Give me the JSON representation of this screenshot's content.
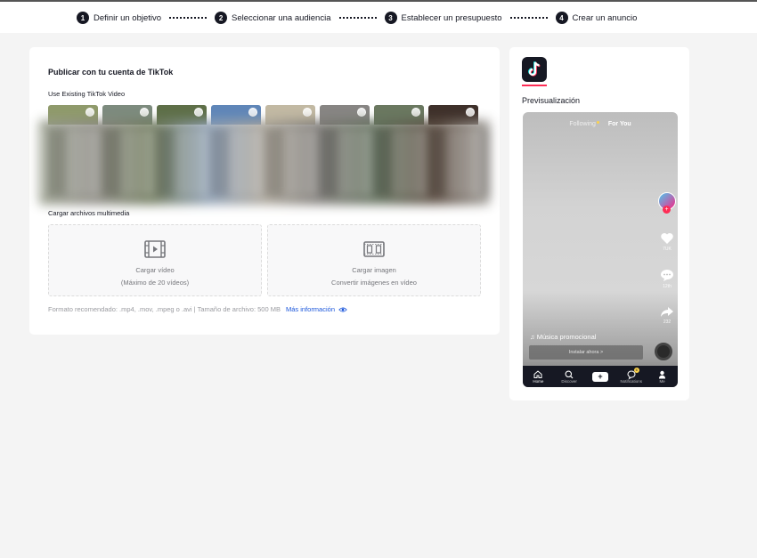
{
  "steps": [
    {
      "num": "1",
      "label": "Definir un objetivo"
    },
    {
      "num": "2",
      "label": "Seleccionar una audiencia"
    },
    {
      "num": "3",
      "label": "Establecer un presupuesto"
    },
    {
      "num": "4",
      "label": "Crear un anuncio"
    }
  ],
  "main": {
    "title": "Publicar con tu cuenta de TikTok",
    "existing_label": "Use Existing TikTok Video",
    "upload_section_label": "Cargar archivos multimedia",
    "upload_video": {
      "title": "Cargar vídeo",
      "subtitle": "(Máximo de 20 vídeos)",
      "icon": "video-icon"
    },
    "upload_image": {
      "title": "Cargar imagen",
      "subtitle": "Convertir imágenes en vídeo",
      "icon": "image-strip-icon"
    },
    "footnote": "Formato recomendado: .mp4, .mov, .mpeg o .avi | Tamaño de archivo: 500 MB",
    "more_info": "Más información",
    "thumb_colors": [
      "#8f9a6b",
      "#7d8b7e",
      "#5e6f48",
      "#5f86b8",
      "#c2b9a3",
      "#878583",
      "#6a7860",
      "#3e302a"
    ]
  },
  "preview": {
    "title": "Previsualización",
    "feed_following": "Following",
    "feed_foryou": "For You",
    "likes": "7UK",
    "comments": "12th",
    "shares": "232",
    "music": "♫ Música promocional",
    "install": "Instalar ahora >",
    "tabs": [
      "Home",
      "Discover",
      "",
      "Notifications",
      "Me"
    ],
    "notif_count": "6",
    "accent": "#fe2c55"
  }
}
